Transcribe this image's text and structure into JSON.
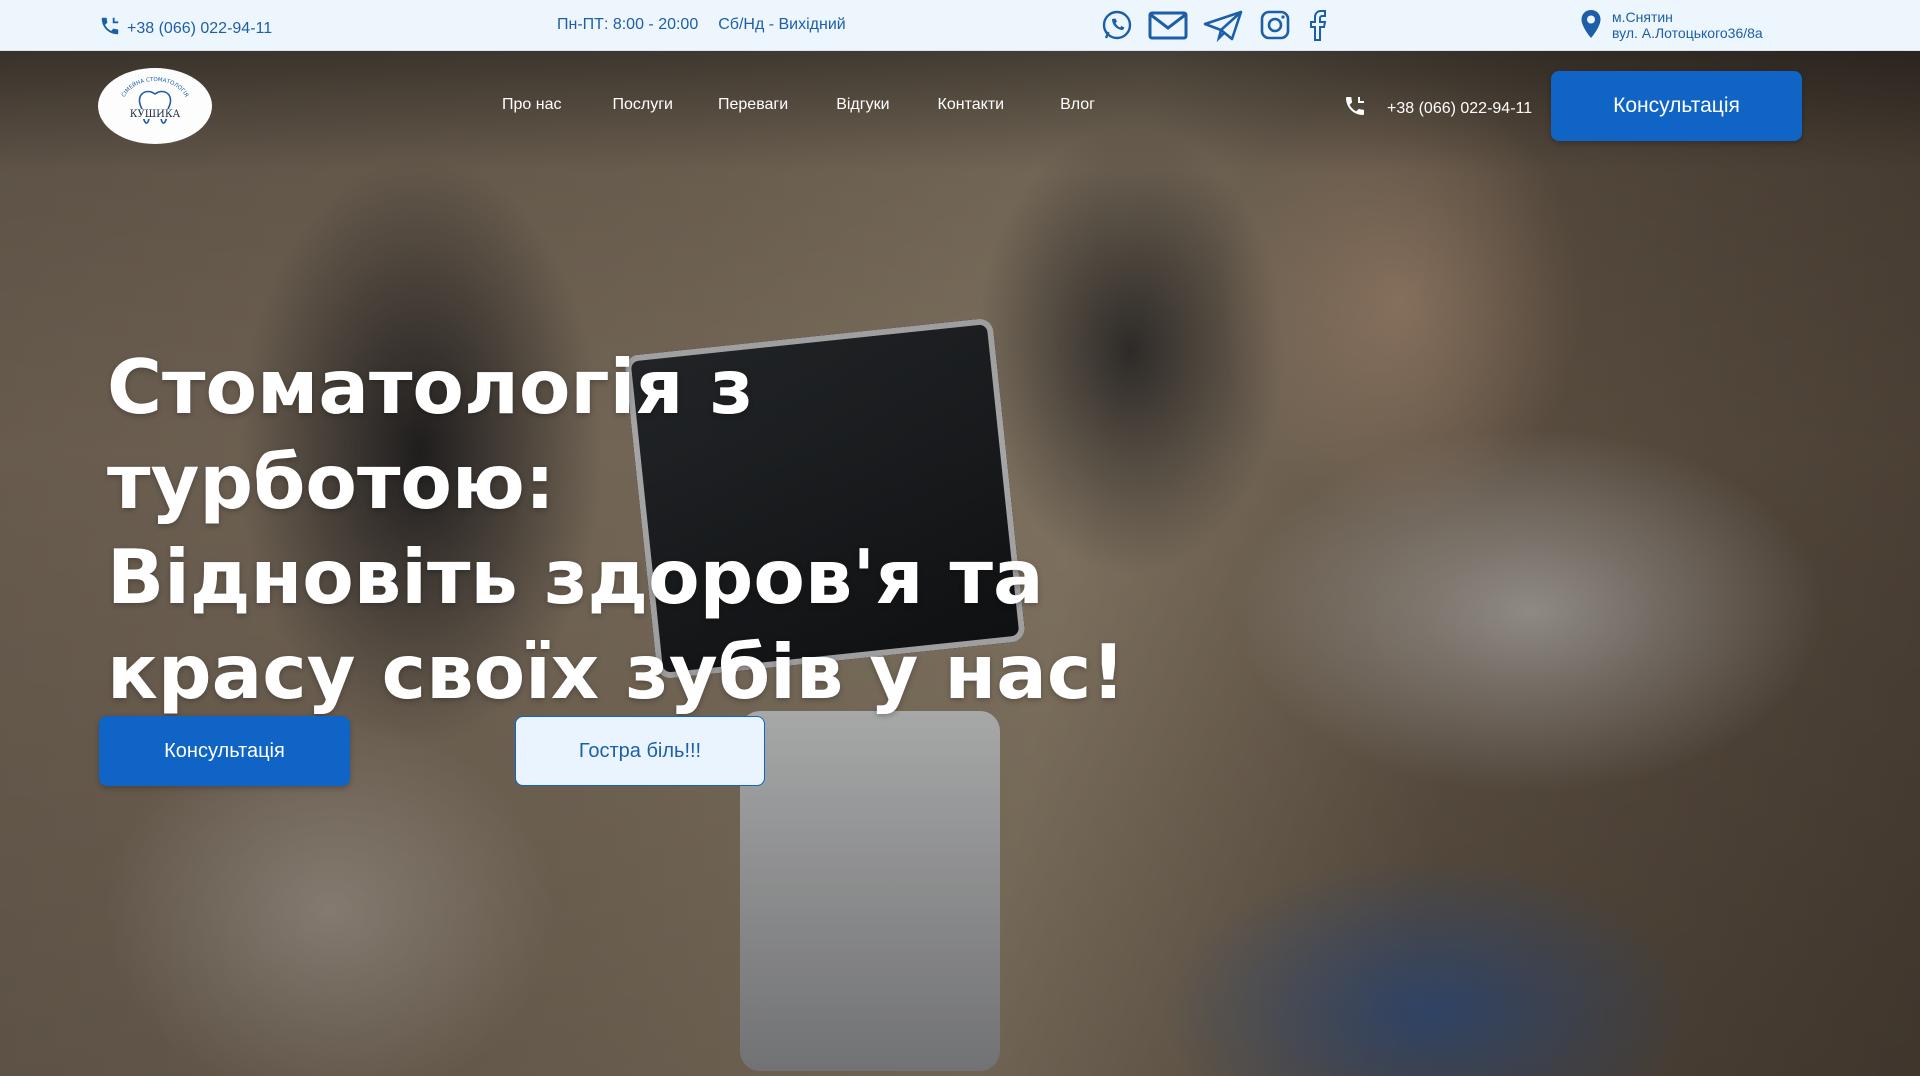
{
  "topbar": {
    "phone": "+38 (066) 022-94-11",
    "hours_weekdays": "Пн-ПТ: 8:00 - 20:00",
    "hours_weekend": "Сб/Нд - Вихідний",
    "socials": [
      "whatsapp-icon",
      "mail-icon",
      "telegram-icon",
      "instagram-icon",
      "facebook-icon"
    ],
    "address_city": "м.Снятин",
    "address_street": "вул. А.Лотоцького36/8а"
  },
  "logo": {
    "name": "КУШИКА",
    "arc_text": "СІМЕЙНА СТОМАТОЛОГІЯ"
  },
  "nav": {
    "items": [
      "Про нас",
      "Послуги",
      "Переваги",
      "Відгуки",
      "Контакти",
      "Влог"
    ],
    "phone": "+38 (066) 022-94-11",
    "cta": "Консультація"
  },
  "hero": {
    "headline_line1": "Стоматологія з турботою:",
    "headline_line2": "Відновіть здоров'я та",
    "headline_line3": "красу своїх зубів у нас!",
    "primary_button": "Консультація",
    "secondary_button": "Гостра біль!!!"
  },
  "colors": {
    "brand_blue": "#0f64c6",
    "topbar_bg": "#eef6fd",
    "topbar_text": "#1c5fa8",
    "secondary_btn_bg": "#eaf4fe"
  }
}
